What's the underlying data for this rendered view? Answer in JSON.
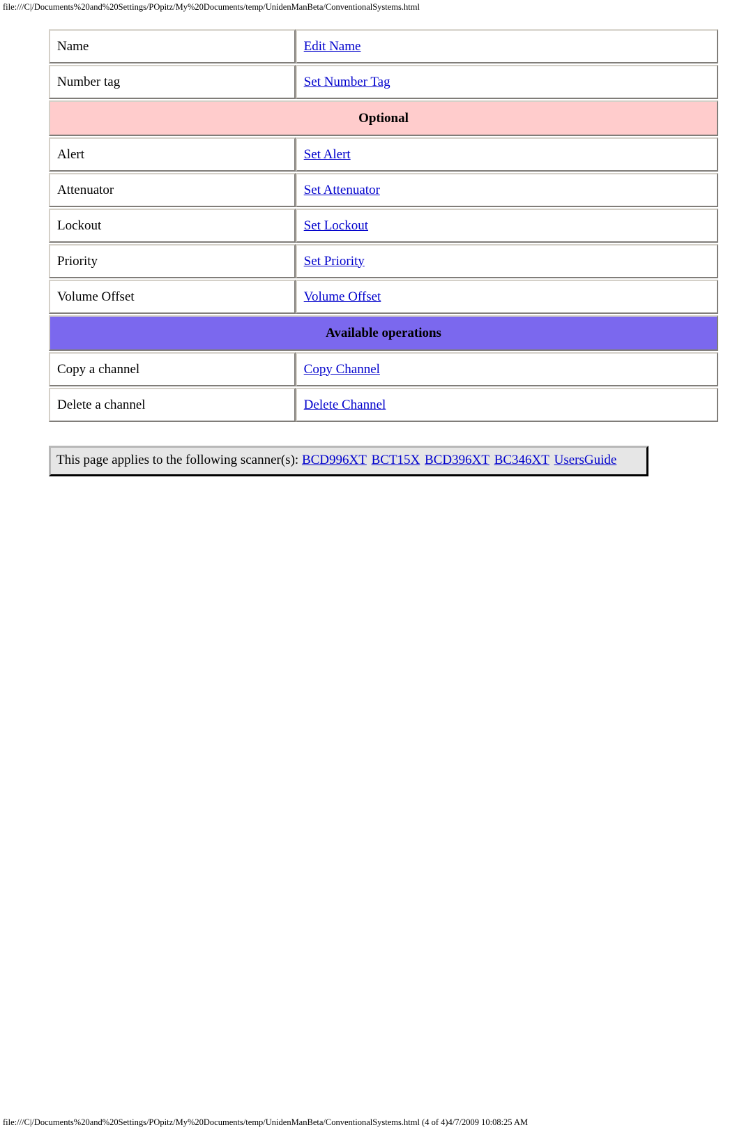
{
  "header": {
    "url": "file:///C|/Documents%20and%20Settings/POpitz/My%20Documents/temp/UnidenManBeta/ConventionalSystems.html"
  },
  "footer": {
    "url": "file:///C|/Documents%20and%20Settings/POpitz/My%20Documents/temp/UnidenManBeta/ConventionalSystems.html (4 of 4)4/7/2009 10:08:25 AM"
  },
  "colors": {
    "optional_banner": "#FFCCCC",
    "operations_banner": "#7B68EE",
    "link": "#0000CC",
    "note_background": "#E6E6E6"
  },
  "table": {
    "rows": [
      {
        "type": "item",
        "label": "Name",
        "action": "Edit Name"
      },
      {
        "type": "item",
        "label": "Number tag",
        "action": "Set Number Tag"
      },
      {
        "type": "banner",
        "style": "optional",
        "label": "Optional"
      },
      {
        "type": "item",
        "label": "Alert",
        "action": "Set Alert"
      },
      {
        "type": "item",
        "label": "Attenuator",
        "action": "Set Attenuator"
      },
      {
        "type": "item",
        "label": "Lockout",
        "action": "Set Lockout"
      },
      {
        "type": "item",
        "label": "Priority",
        "action": "Set Priority"
      },
      {
        "type": "item",
        "label": "Volume Offset",
        "action": "Volume Offset"
      },
      {
        "type": "banner",
        "style": "operations",
        "label": "Available operations"
      },
      {
        "type": "item",
        "label": "Copy a channel",
        "action": "Copy Channel"
      },
      {
        "type": "item",
        "label": "Delete a channel",
        "action": "Delete Channel"
      }
    ]
  },
  "note": {
    "intro": "This page applies to the following scanner(s):",
    "scanners": [
      "BCD996XT",
      "BCT15X",
      "BCD396XT",
      "BC346XT"
    ],
    "guide_link": "UsersGuide"
  }
}
